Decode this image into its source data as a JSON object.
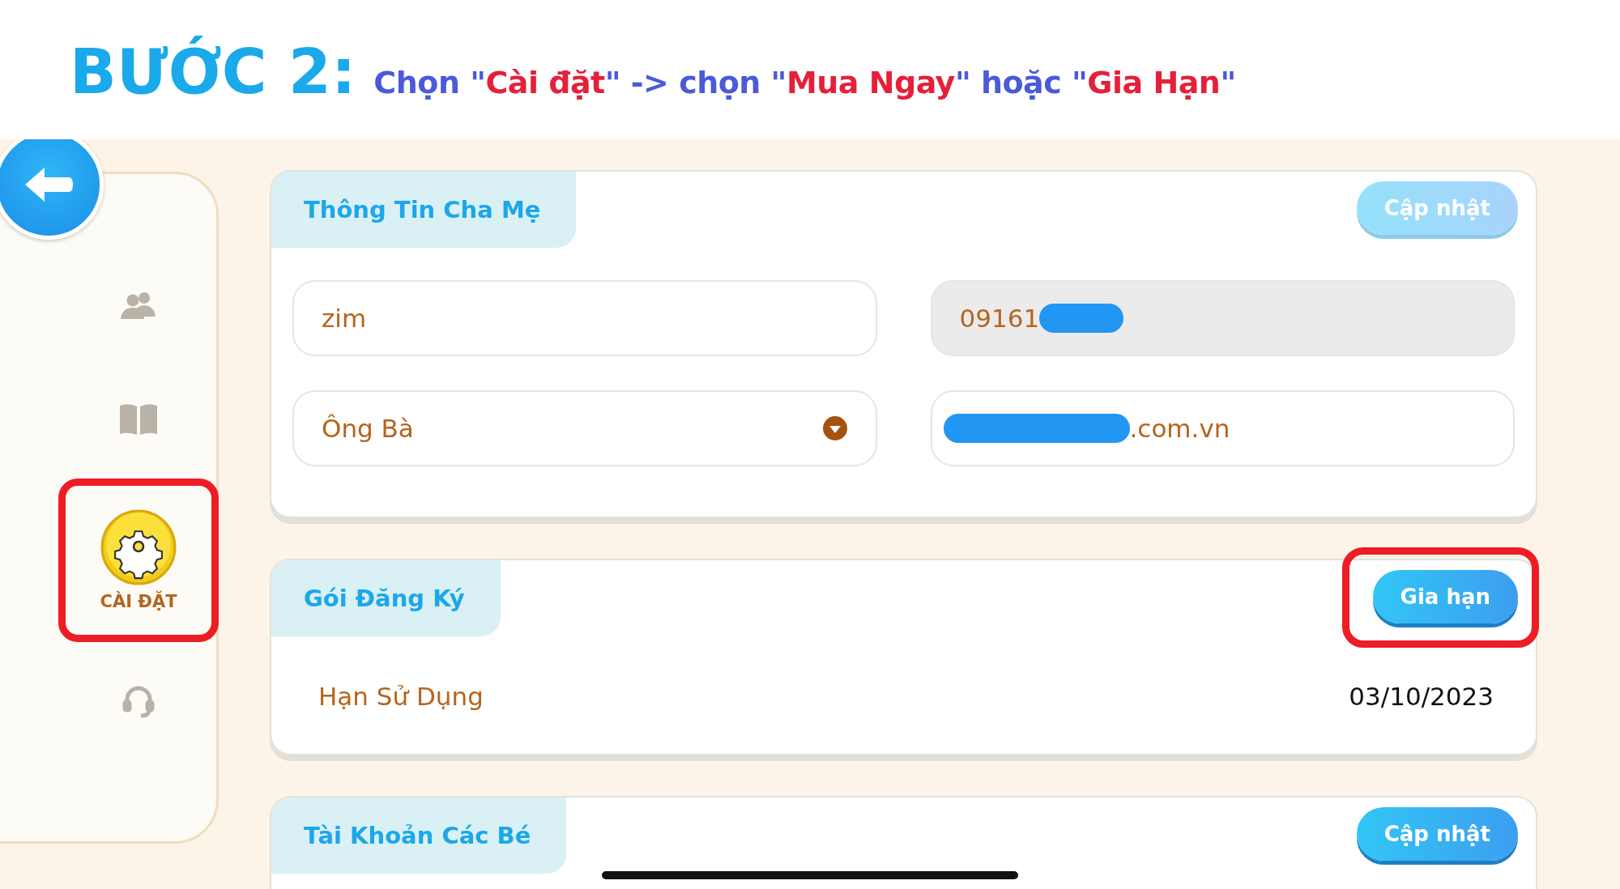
{
  "heading": {
    "step": "BƯỚC 2:",
    "instruction": [
      {
        "text": "Chọn \"",
        "color": "#4a5ad8"
      },
      {
        "text": "Cài đặt",
        "color": "#e5203a"
      },
      {
        "text": "\" -> chọn \"",
        "color": "#4a5ad8"
      },
      {
        "text": "Mua Ngay",
        "color": "#e5203a"
      },
      {
        "text": "\" hoặc \"",
        "color": "#4a5ad8"
      },
      {
        "text": "Gia Hạn",
        "color": "#e5203a"
      },
      {
        "text": "\"",
        "color": "#4a5ad8"
      }
    ]
  },
  "sidebar": {
    "items": [
      {
        "kind": "people",
        "selected": false,
        "highlighted": false
      },
      {
        "kind": "book",
        "selected": false,
        "highlighted": false
      },
      {
        "kind": "settings",
        "label": "CÀI ĐẶT",
        "selected": true,
        "highlighted": true
      },
      {
        "kind": "headset",
        "selected": false,
        "highlighted": false
      }
    ]
  },
  "cards": [
    {
      "kind": "form",
      "title": "Thông Tin Cha Mẹ",
      "button": {
        "label": "Cập nhật",
        "disabled": true,
        "highlighted": false
      },
      "fields": [
        {
          "kind": "text",
          "value": "zim",
          "disabled": false
        },
        {
          "kind": "text",
          "value": "09161",
          "disabled": true,
          "redacted_end": true
        },
        {
          "kind": "select",
          "value": "Ông Bà",
          "disabled": false
        },
        {
          "kind": "text",
          "value": ".com.vn",
          "disabled": false,
          "redacted_start": true
        }
      ]
    },
    {
      "kind": "info",
      "title": "Gói Đăng Ký",
      "button": {
        "label": "Gia hạn",
        "disabled": false,
        "highlighted": true
      },
      "rows": [
        {
          "label": "Hạn Sử Dụng",
          "value": "03/10/2023"
        }
      ]
    },
    {
      "kind": "form",
      "title": "Tài Khoản Các Bé",
      "button": {
        "label": "Cập nhật",
        "disabled": false,
        "highlighted": false
      }
    }
  ]
}
